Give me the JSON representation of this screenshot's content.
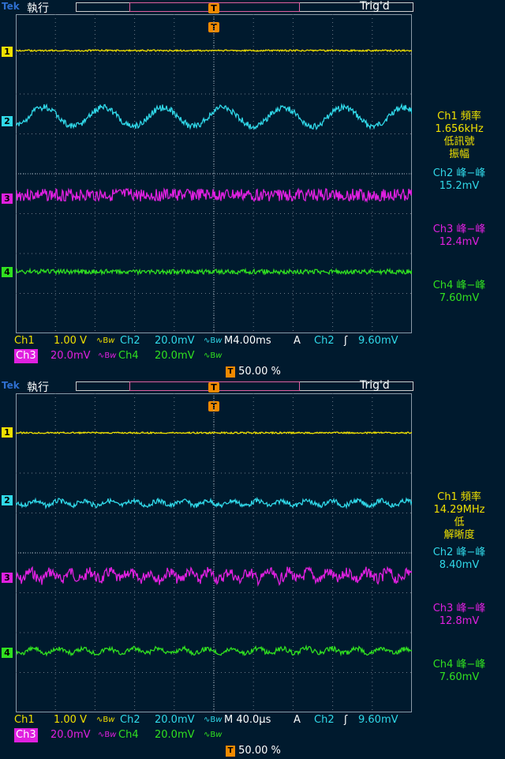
{
  "colors": {
    "ch1": "#f0e000",
    "ch2": "#30d8e8",
    "ch3": "#e020e0",
    "ch4": "#30e020",
    "accent": "#f08a00"
  },
  "screens": [
    {
      "brand": "Tek",
      "run_state": "執行",
      "trig_state": "Trig'd",
      "trigger_marker": "T",
      "channel_markers": [
        "1",
        "2",
        "3",
        "4"
      ],
      "measurements": [
        {
          "label": "Ch1 頻率",
          "value": "1.656kHz",
          "note1": "低訊號",
          "note2": "振幅"
        },
        {
          "label": "Ch2 峰−峰",
          "value": "15.2mV"
        },
        {
          "label": "Ch3 峰−峰",
          "value": "12.4mV"
        },
        {
          "label": "Ch4 峰−峰",
          "value": "7.60mV"
        }
      ],
      "status": {
        "ch1": "Ch1",
        "ch1_scale": "1.00 V",
        "ch1_bw": "∿B𝘸",
        "ch2": "Ch2",
        "ch2_scale": "20.0mV",
        "ch2_bw": "∿B𝘸",
        "timebase": "M4.00ms",
        "trig_mode": "A",
        "trig_src": "Ch2",
        "trig_slope": "ʃ",
        "trig_level": "9.60mV",
        "ch3": "Ch3",
        "ch3_scale": "20.0mV",
        "ch3_bw": "∿B𝘸",
        "ch4": "Ch4",
        "ch4_scale": "20.0mV",
        "ch4_bw": "∿B𝘸",
        "trig_pos": "50.00 %"
      },
      "waveforms": {
        "ch2_cycles": 6.6,
        "ch2_amplitude_mv": 15.2
      }
    },
    {
      "brand": "Tek",
      "run_state": "執行",
      "trig_state": "Trig'd",
      "trigger_marker": "T",
      "channel_markers": [
        "1",
        "2",
        "3",
        "4"
      ],
      "measurements": [
        {
          "label": "Ch1 頻率",
          "value": "14.29MHz",
          "note1": "低",
          "note2": "解晰度"
        },
        {
          "label": "Ch2 峰−峰",
          "value": "8.40mV"
        },
        {
          "label": "Ch3 峰−峰",
          "value": "12.8mV"
        },
        {
          "label": "Ch4 峰−峰",
          "value": "7.60mV"
        }
      ],
      "status": {
        "ch1": "Ch1",
        "ch1_scale": "1.00 V",
        "ch1_bw": "∿B𝘸",
        "ch2": "Ch2",
        "ch2_scale": "20.0mV",
        "ch2_bw": "∿B𝘸",
        "timebase": "M 40.0µs",
        "trig_mode": "A",
        "trig_src": "Ch2",
        "trig_slope": "ʃ",
        "trig_level": "9.60mV",
        "ch3": "Ch3",
        "ch3_scale": "20.0mV",
        "ch3_bw": "∿B𝘸",
        "ch4": "Ch4",
        "ch4_scale": "20.0mV",
        "ch4_bw": "∿B𝘸",
        "trig_pos": "50.00 %"
      },
      "waveforms": {
        "ch2_cycles": 0,
        "ch2_amplitude_mv": 8.4
      }
    }
  ]
}
